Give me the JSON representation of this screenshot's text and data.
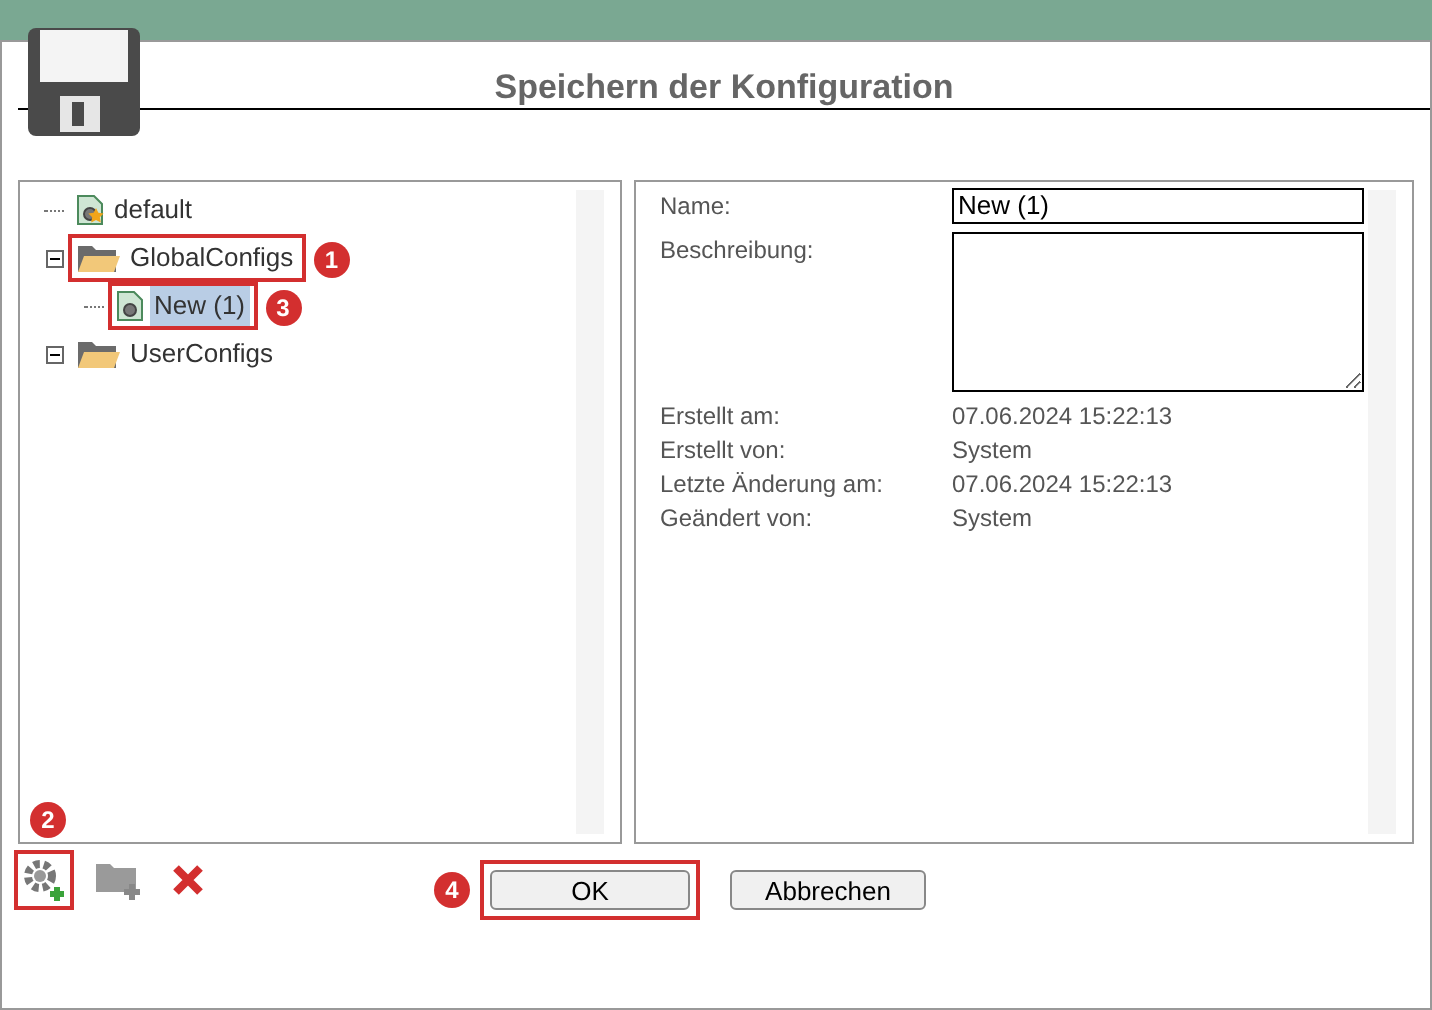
{
  "dialog": {
    "title": "Speichern der Konfiguration"
  },
  "tree": [
    {
      "label": "default",
      "kind": "config",
      "selected": false
    },
    {
      "label": "GlobalConfigs",
      "kind": "folder",
      "expanded": true,
      "selected": false,
      "callout": "1",
      "children": [
        {
          "label": "New (1)",
          "kind": "config",
          "selected": true,
          "callout": "3"
        }
      ]
    },
    {
      "label": "UserConfigs",
      "kind": "folder",
      "expanded": true,
      "selected": false
    }
  ],
  "details": {
    "name_label": "Name:",
    "name_value": "New (1)",
    "description_label": "Beschreibung:",
    "fields": [
      {
        "label": "Erstellt am:",
        "value": "07.06.2024 15:22:13"
      },
      {
        "label": "Erstellt von:",
        "value": "System"
      },
      {
        "label": "Letzte Änderung am:",
        "value": "07.06.2024 15:22:13"
      },
      {
        "label": "Geändert von:",
        "value": "System"
      }
    ]
  },
  "toolbar": [
    {
      "kind": "add-config",
      "callout": "2"
    },
    {
      "kind": "add-folder"
    },
    {
      "kind": "delete"
    }
  ],
  "buttons": [
    {
      "label": "OK",
      "callout": "4"
    },
    {
      "label": "Abbrechen"
    }
  ]
}
